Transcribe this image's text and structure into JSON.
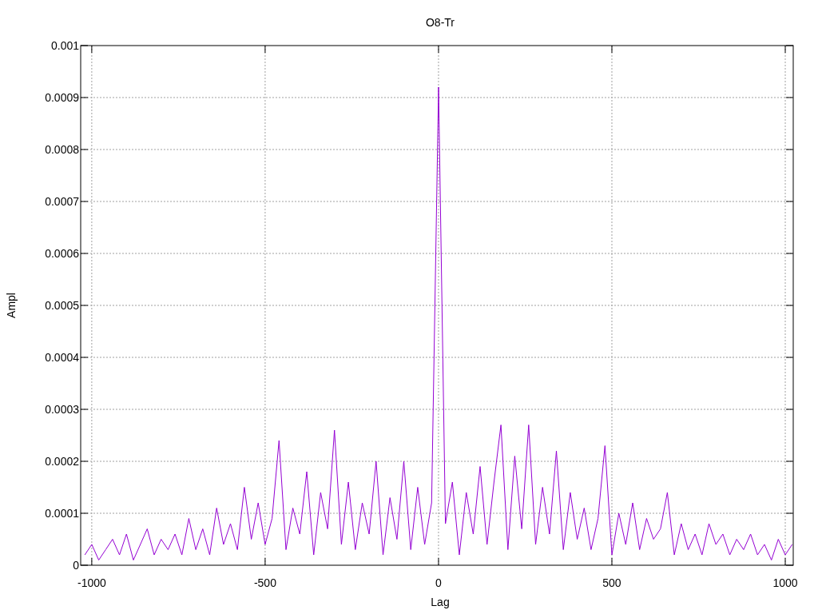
{
  "chart": {
    "chart_data": {
      "type": "line",
      "title": "O8-Tr",
      "xlabel": "Lag",
      "ylabel": "Ampl",
      "x": [
        -1020,
        -1000,
        -980,
        -960,
        -940,
        -920,
        -900,
        -880,
        -860,
        -840,
        -820,
        -800,
        -780,
        -760,
        -740,
        -720,
        -700,
        -680,
        -660,
        -640,
        -620,
        -600,
        -580,
        -560,
        -540,
        -520,
        -500,
        -480,
        -460,
        -440,
        -420,
        -400,
        -380,
        -360,
        -340,
        -320,
        -300,
        -280,
        -260,
        -240,
        -220,
        -200,
        -180,
        -160,
        -140,
        -120,
        -100,
        -80,
        -60,
        -40,
        -20,
        0,
        20,
        40,
        60,
        80,
        100,
        120,
        140,
        160,
        180,
        200,
        220,
        240,
        260,
        280,
        300,
        320,
        340,
        360,
        380,
        400,
        420,
        440,
        460,
        480,
        500,
        520,
        540,
        560,
        580,
        600,
        620,
        640,
        660,
        680,
        700,
        720,
        740,
        760,
        780,
        800,
        820,
        840,
        860,
        880,
        900,
        920,
        940,
        960,
        980,
        1000,
        1020
      ],
      "grid": true,
      "series": [
        {
          "color": "#9400d3",
          "values": [
            2e-05,
            4e-05,
            1e-05,
            3e-05,
            5e-05,
            2e-05,
            6e-05,
            1e-05,
            4e-05,
            7e-05,
            2e-05,
            5e-05,
            3e-05,
            6e-05,
            2e-05,
            9e-05,
            3e-05,
            7e-05,
            2e-05,
            0.00011,
            4e-05,
            8e-05,
            3e-05,
            0.00015,
            5e-05,
            0.00012,
            4e-05,
            9e-05,
            0.00024,
            3e-05,
            0.00011,
            6e-05,
            0.00018,
            2e-05,
            0.00014,
            7e-05,
            0.00026,
            4e-05,
            0.00016,
            3e-05,
            0.00012,
            6e-05,
            0.0002,
            2e-05,
            0.00013,
            5e-05,
            0.0002,
            3e-05,
            0.00015,
            4e-05,
            0.00012,
            0.00092,
            8e-05,
            0.00016,
            2e-05,
            0.00014,
            6e-05,
            0.00019,
            4e-05,
            0.00016,
            0.00027,
            3e-05,
            0.00021,
            7e-05,
            0.00027,
            4e-05,
            0.00015,
            6e-05,
            0.00022,
            3e-05,
            0.00014,
            5e-05,
            0.00011,
            3e-05,
            9e-05,
            0.00023,
            2e-05,
            0.0001,
            4e-05,
            0.00012,
            3e-05,
            9e-05,
            5e-05,
            7e-05,
            0.00014,
            2e-05,
            8e-05,
            3e-05,
            6e-05,
            2e-05,
            8e-05,
            4e-05,
            6e-05,
            2e-05,
            5e-05,
            3e-05,
            6e-05,
            2e-05,
            4e-05,
            1e-05,
            5e-05,
            2e-05,
            4e-05
          ]
        }
      ],
      "xlim": [
        -1032,
        1023
      ],
      "ylim": [
        0,
        0.001
      ],
      "xticks": [
        -1000,
        -500,
        0,
        500,
        1000
      ],
      "yticks": [
        {
          "value": 0,
          "label": "0"
        },
        {
          "value": 0.0001,
          "label": "0.0001"
        },
        {
          "value": 0.0002,
          "label": "0.0002"
        },
        {
          "value": 0.0003,
          "label": "0.0003"
        },
        {
          "value": 0.0004,
          "label": "0.0004"
        },
        {
          "value": 0.0005,
          "label": "0.0005"
        },
        {
          "value": 0.0006,
          "label": "0.0006"
        },
        {
          "value": 0.0007,
          "label": "0.0007"
        },
        {
          "value": 0.0008,
          "label": "0.0008"
        },
        {
          "value": 0.0009,
          "label": "0.0009"
        },
        {
          "value": 0.001,
          "label": "0.001"
        }
      ]
    }
  }
}
